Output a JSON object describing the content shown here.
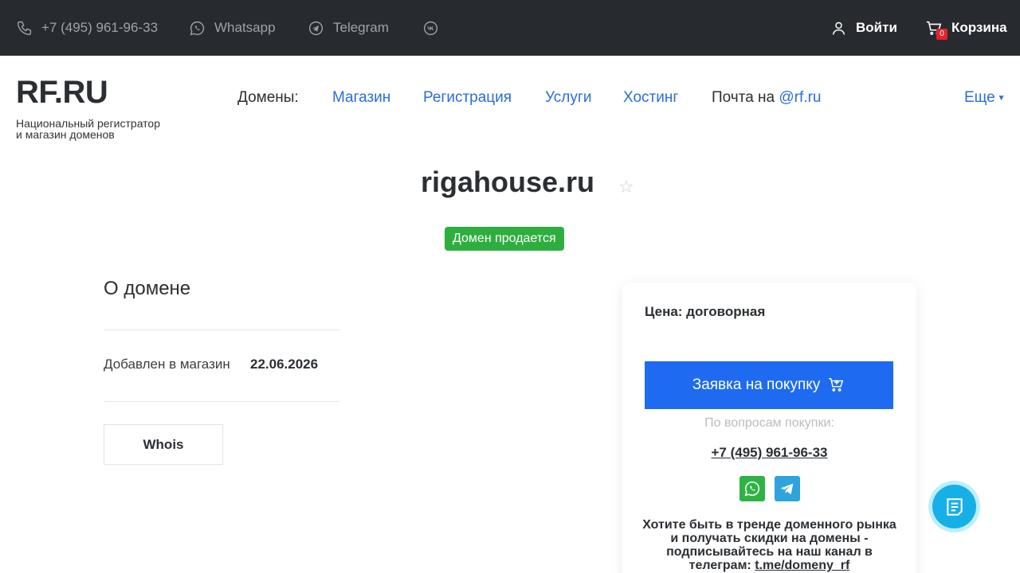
{
  "topbar": {
    "phone": "+7 (495) 961-96-33",
    "whatsapp": "Whatsapp",
    "telegram": "Telegram",
    "login": "Войти",
    "cart": "Корзина",
    "cart_count": "0"
  },
  "header": {
    "logo": "RF.RU",
    "tagline_line1": "Национальный регистратор",
    "tagline_line2": "и магазин доменов",
    "nav_label": "Домены:",
    "nav": [
      "Магазин",
      "Регистрация",
      "Услуги",
      "Хостинг"
    ],
    "mail_prefix": "Почта на ",
    "mail_link": "@rf.ru",
    "more": "Еще"
  },
  "domain": {
    "name": "rigahouse.ru",
    "status_badge": "Домен продается"
  },
  "about": {
    "title": "О домене",
    "added_label": "Добавлен в магазин",
    "added_value": "22.06.2026",
    "whois": "Whois"
  },
  "card": {
    "price": "Цена: договорная",
    "buy_button": "Заявка на покупку",
    "questions": "По вопросам покупки:",
    "phone": "+7 (495) 961-96-33",
    "promo_text": "Хотите быть в тренде доменного рынка и получать скидки на домены - подписывайтесь на наш канал в телеграм: ",
    "promo_link": "t.me/domeny_rf"
  },
  "colors": {
    "topbar_bg": "#272a2e",
    "link": "#2a6ed8",
    "primary_button": "#1e6bf1",
    "sale_badge": "#2eae3e",
    "whatsapp": "#2fb344",
    "telegram": "#2fa3dc",
    "chat_fab": "#17b0e6"
  },
  "icons": [
    "phone-icon",
    "whatsapp-icon",
    "telegram-icon",
    "vk-icon",
    "user-icon",
    "cart-icon",
    "star-icon",
    "add-to-cart-icon",
    "chat-icon"
  ]
}
